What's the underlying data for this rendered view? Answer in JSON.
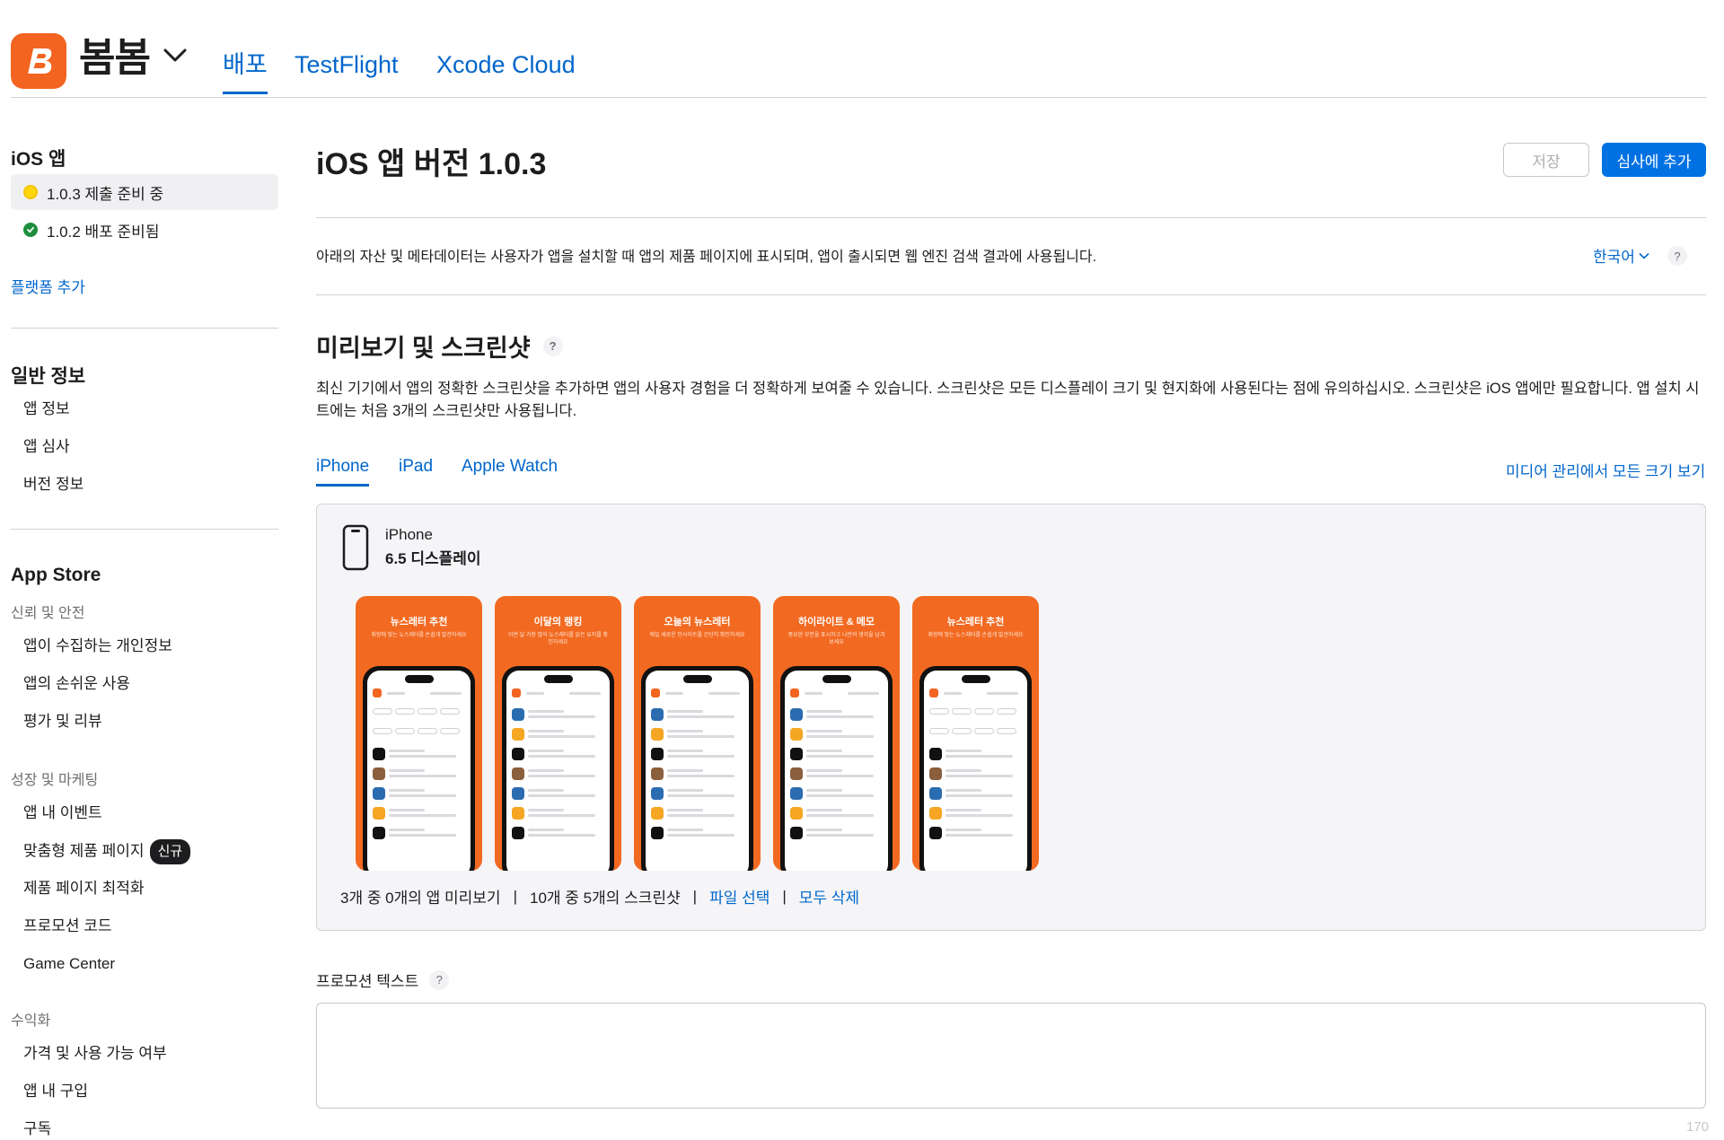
{
  "header": {
    "app_name": "봄봄",
    "tabs": [
      {
        "label": "배포",
        "active": true
      },
      {
        "label": "TestFlight",
        "active": false
      },
      {
        "label": "Xcode Cloud",
        "active": false
      }
    ]
  },
  "sidebar": {
    "ios_section": "iOS 앱",
    "versions": [
      {
        "label": "1.0.3 제출 준비 중",
        "status": "yellow"
      },
      {
        "label": "1.0.2 배포 준비됨",
        "status": "green"
      }
    ],
    "add_platform": "플랫폼 추가",
    "general_section": "일반 정보",
    "general_items": [
      "앱 정보",
      "앱 심사",
      "버전 정보"
    ],
    "appstore_section": "App Store",
    "trust_heading": "신뢰 및 안전",
    "trust_items": [
      "앱이 수집하는 개인정보",
      "앱의 손쉬운 사용",
      "평가 및 리뷰"
    ],
    "growth_heading": "성장 및 마케팅",
    "growth_items": [
      "앱 내 이벤트",
      "맞춤형 제품 페이지",
      "제품 페이지 최적화",
      "프로모션 코드",
      "Game Center"
    ],
    "new_badge": "신규",
    "monetization_heading": "수익화",
    "monetization_items": [
      "가격 및 사용 가능 여부",
      "앱 내 구입",
      "구독"
    ]
  },
  "main": {
    "title": "iOS 앱 버전 1.0.3",
    "save_label": "저장",
    "submit_label": "심사에 추가",
    "intro": "아래의 자산 및 메타데이터는 사용자가 앱을 설치할 때 앱의 제품 페이지에 표시되며, 앱이 출시되면 웹 엔진 검색 결과에 사용됩니다.",
    "language": "한국어",
    "help": "?",
    "preview_title": "미리보기 및 스크린샷",
    "preview_desc": "최신 기기에서 앱의 정확한 스크린샷을 추가하면 앱의 사용자 경험을 더 정확하게 보여줄 수 있습니다. 스크린샷은 모든 디스플레이 크기 및 현지화에 사용된다는 점에 유의하십시오. 스크린샷은 iOS 앱에만 필요합니다. 앱 설치 시트에는 처음 3개의 스크린샷만 사용됩니다.",
    "device_tabs": [
      {
        "label": "iPhone",
        "active": true
      },
      {
        "label": "iPad",
        "active": false
      },
      {
        "label": "Apple Watch",
        "active": false
      }
    ],
    "media_link": "미디어 관리에서 모든 크기 보기",
    "device_name": "iPhone",
    "device_size": "6.5 디스플레이",
    "screenshots": [
      {
        "title": "뉴스레터 추천",
        "subtitle": "취향에 맞는 뉴스레터를 손쉽게 발견하세요"
      },
      {
        "title": "이달의 랭킹",
        "subtitle": "이번 달 가장 많이 뉴스레터를 읽은 유저를 확인하세요"
      },
      {
        "title": "오늘의 뉴스레터",
        "subtitle": "매일 새로운 인사이트를 간단히 확인하세요"
      },
      {
        "title": "하이라이트 & 메모",
        "subtitle": "중요한 부분을 표시하고 나만의 생각을 남겨보세요"
      },
      {
        "title": "뉴스레터 추천",
        "subtitle": "취향에 맞는 뉴스레터를 손쉽게 발견하세요"
      }
    ],
    "footer": {
      "previews": "3개 중 0개의 앱 미리보기",
      "screenshots": "10개 중 5개의 스크린샷",
      "choose_file": "파일 선택",
      "delete_all": "모두 삭제",
      "separator": "|"
    },
    "promo_label": "프로모션 텍스트",
    "promo_value": "",
    "char_count": "170"
  },
  "colors": {
    "accent": "#0066cc",
    "brand": "#f26420",
    "primary_button": "#0071e3"
  }
}
